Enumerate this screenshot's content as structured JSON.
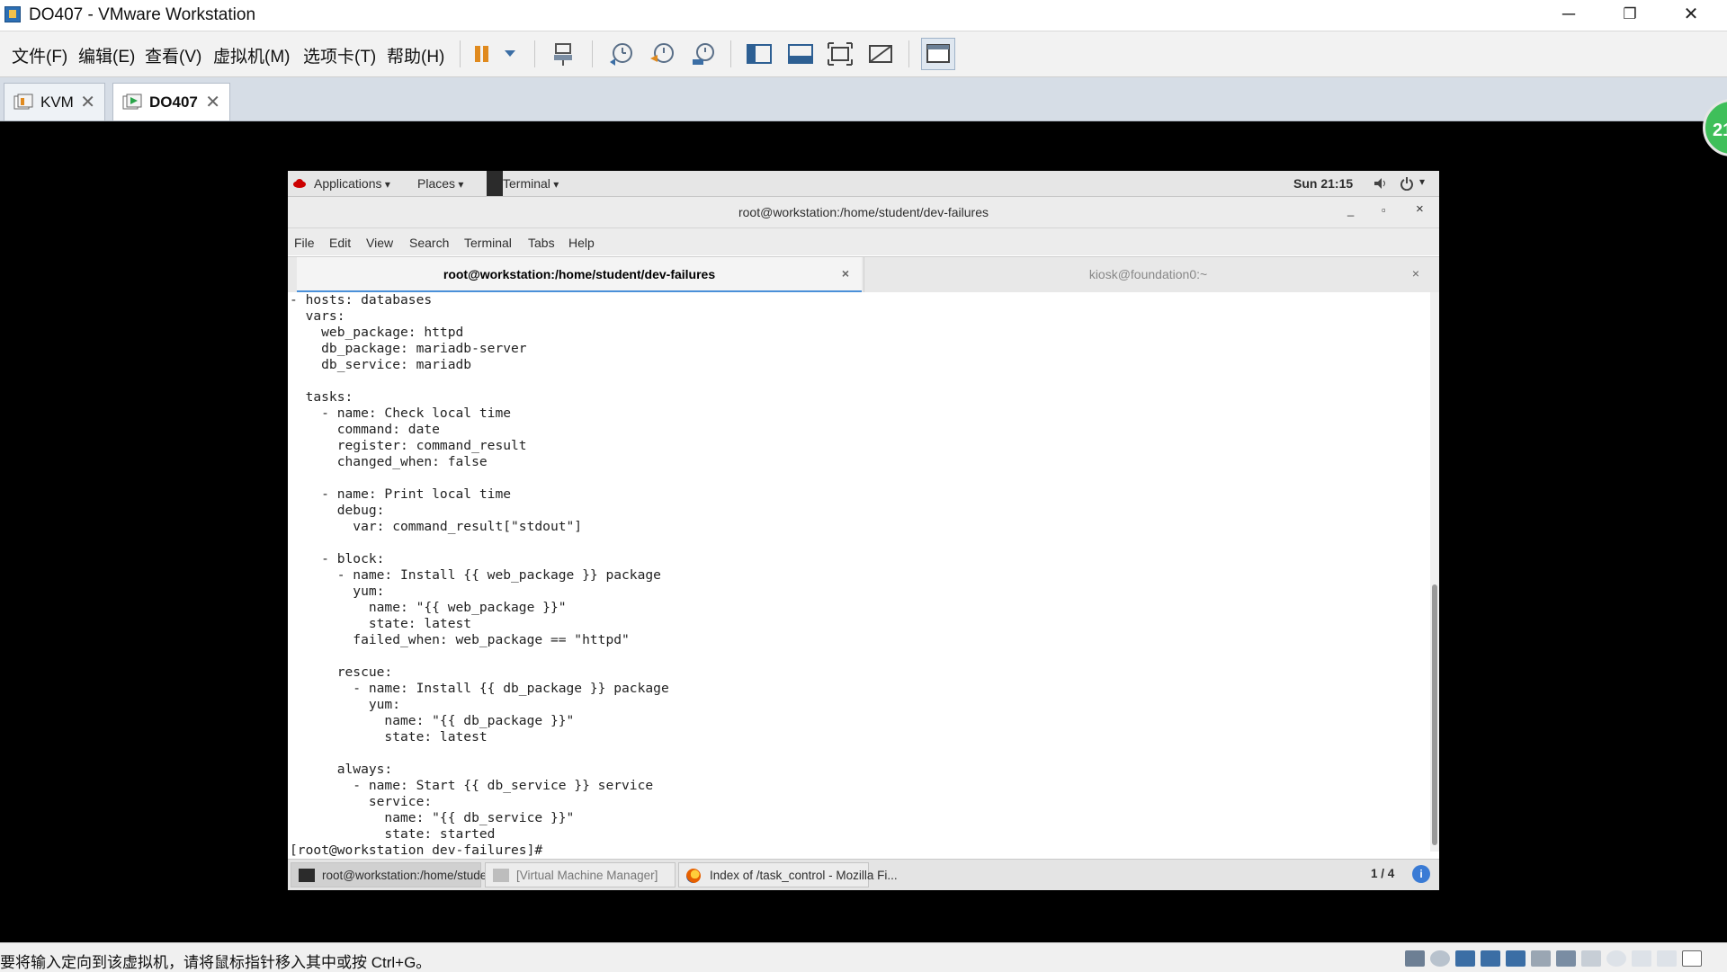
{
  "window": {
    "title": "DO407 - VMware Workstation",
    "controls": [
      "─",
      "❐",
      "✕"
    ]
  },
  "host_menu": [
    "文件(F)",
    "编辑(E)",
    "查看(V)",
    "虚拟机(M)",
    "选项卡(T)",
    "帮助(H)"
  ],
  "vm_tabs": [
    {
      "label": "KVM",
      "close": "✕"
    },
    {
      "label": "DO407",
      "close": "✕"
    }
  ],
  "notification_count": "21",
  "guest": {
    "topbar": {
      "applications": "Applications",
      "places": "Places",
      "terminal": "Terminal",
      "clock": "Sun 21:15"
    },
    "terminal_window": {
      "title": "root@workstation:/home/student/dev-failures",
      "controls": [
        "_",
        "▫",
        "×"
      ],
      "menu": [
        "File",
        "Edit",
        "View",
        "Search",
        "Terminal",
        "Tabs",
        "Help"
      ],
      "tabs": [
        {
          "label": "root@workstation:/home/student/dev-failures",
          "close": "×"
        },
        {
          "label": "kiosk@foundation0:~",
          "close": "×"
        }
      ],
      "lines": [
        "- hosts: databases",
        "  vars:",
        "    web_package: httpd",
        "    db_package: mariadb-server",
        "    db_service: mariadb",
        "",
        "  tasks:",
        "    - name: Check local time",
        "      command: date",
        "      register: command_result",
        "      changed_when: false",
        "",
        "    - name: Print local time",
        "      debug:",
        "        var: command_result[\"stdout\"]",
        "",
        "    - block:",
        "      - name: Install {{ web_package }} package",
        "        yum:",
        "          name: \"{{ web_package }}\"",
        "          state: latest",
        "        failed_when: web_package == \"httpd\"",
        "",
        "      rescue:",
        "        - name: Install {{ db_package }} package",
        "          yum:",
        "            name: \"{{ db_package }}\"",
        "            state: latest",
        "",
        "      always:",
        "        - name: Start {{ db_service }} service",
        "          service:",
        "            name: \"{{ db_service }}\"",
        "            state: started",
        "[root@workstation dev-failures]# "
      ]
    },
    "taskbar": {
      "items": [
        "root@workstation:/home/student...",
        "[Virtual Machine Manager]",
        "Index of /task_control - Mozilla Fi..."
      ],
      "workspace": "1 / 4",
      "info_icon": "i"
    }
  },
  "statusbar": {
    "message": "要将输入定向到该虚拟机，请将鼠标指针移入其中或按 Ctrl+G。"
  },
  "colors": {
    "vm_background": "#000000",
    "tab_bar": "#d6dde6",
    "terminal_text": "#222222",
    "active_tab_underline": "#4a90d9",
    "pause_orange": "#e08a1e",
    "notification_green": "#3fbf5a"
  }
}
